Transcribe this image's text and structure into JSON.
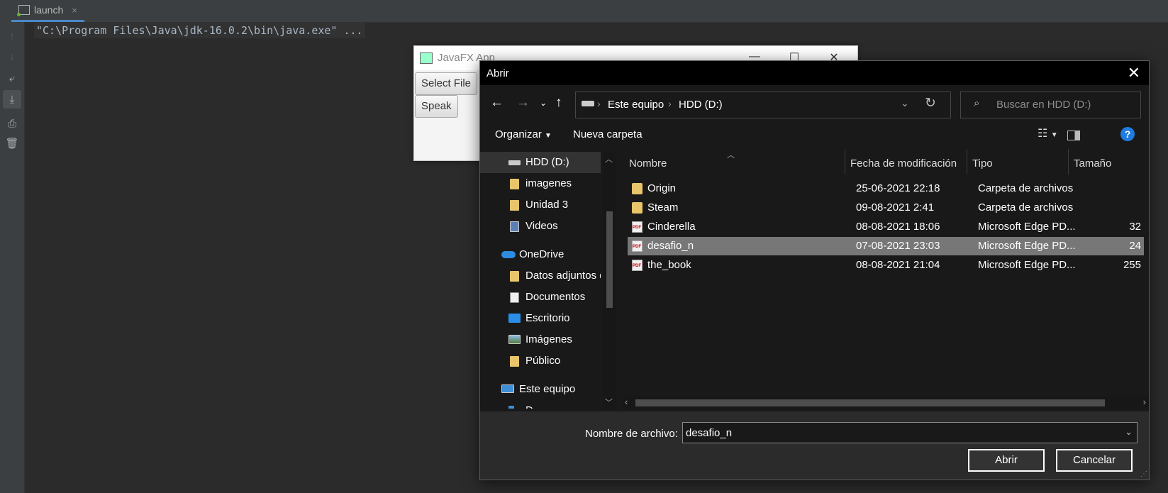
{
  "ide": {
    "tab_label": "launch",
    "tab_close": "×",
    "console_line": "\"C:\\Program Files\\Java\\jdk-16.0.2\\bin\\java.exe\" ...",
    "side_icons": [
      "arrow-up-icon",
      "arrow-down-icon",
      "soft-wrap-icon",
      "scroll-to-end-icon",
      "print-icon",
      "trash-icon"
    ]
  },
  "fx_window": {
    "title": "JavaFX App",
    "select_file_label": "Select File",
    "speak_label": "Speak"
  },
  "dialog": {
    "title": "Abrir",
    "close_glyph": "✕",
    "address": [
      "Este equipo",
      "HDD (D:)"
    ],
    "search_placeholder": "Buscar en HDD (D:)",
    "organize_label": "Organizar",
    "new_folder_label": "Nueva carpeta",
    "help_glyph": "?",
    "nav_items": [
      {
        "label": "HDD (D:)",
        "icon": "drive-icon"
      },
      {
        "label": "imagenes",
        "icon": "folder-icon"
      },
      {
        "label": "Unidad 3",
        "icon": "folder-icon"
      },
      {
        "label": "Videos",
        "icon": "videos-icon"
      },
      {
        "label": "OneDrive",
        "icon": "onedrive-icon"
      },
      {
        "label": "Datos adjuntos de",
        "icon": "folder-icon"
      },
      {
        "label": "Documentos",
        "icon": "documents-icon"
      },
      {
        "label": "Escritorio",
        "icon": "desktop-icon"
      },
      {
        "label": "Imágenes",
        "icon": "pictures-icon"
      },
      {
        "label": "Público",
        "icon": "folder-icon"
      },
      {
        "label": "Este equipo",
        "icon": "computer-icon"
      },
      {
        "label": "D",
        "icon": "drive-icon"
      }
    ],
    "columns": [
      "Nombre",
      "Fecha de modificación",
      "Tipo",
      "Tamaño"
    ],
    "files": [
      {
        "name": "Origin",
        "date": "25-06-2021 22:18",
        "type": "Carpeta de archivos",
        "size": "",
        "icon": "folder-icon",
        "selected": false
      },
      {
        "name": "Steam",
        "date": "09-08-2021 2:41",
        "type": "Carpeta de archivos",
        "size": "",
        "icon": "folder-icon",
        "selected": false
      },
      {
        "name": "Cinderella",
        "date": "08-08-2021 18:06",
        "type": "Microsoft Edge PD...",
        "size": "32",
        "icon": "pdf-icon",
        "selected": false
      },
      {
        "name": "desafio_n",
        "date": "07-08-2021 23:03",
        "type": "Microsoft Edge PD...",
        "size": "24",
        "icon": "pdf-icon",
        "selected": true
      },
      {
        "name": "the_book",
        "date": "08-08-2021 21:04",
        "type": "Microsoft Edge PD...",
        "size": "255",
        "icon": "pdf-icon",
        "selected": false
      }
    ],
    "filename_label": "Nombre de archivo:",
    "filename_value": "desafio_n",
    "open_label": "Abrir",
    "cancel_label": "Cancelar"
  }
}
